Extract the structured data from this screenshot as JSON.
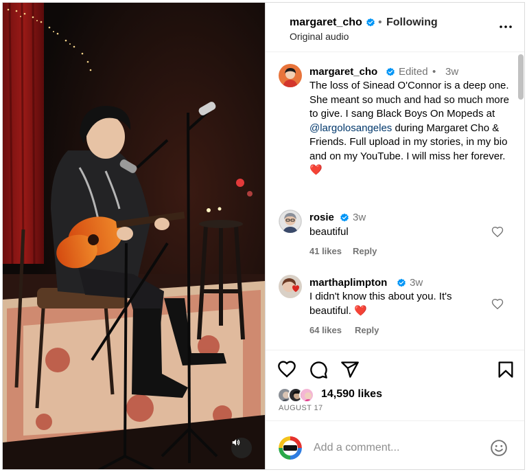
{
  "post": {
    "author": "margaret_cho",
    "follow_state": "Following",
    "separator": "•",
    "audio_label": "Original audio"
  },
  "caption": {
    "username": "margaret_cho",
    "edited": "Edited",
    "separator": "•",
    "age": "3w",
    "text_before": "The loss of Sinead O'Connor is a deep one. She meant so much and had so much more to give. I sang Black Boys On Mopeds at ",
    "mention": "@largolosangeles",
    "text_after": " during Margaret Cho & Friends. Full upload in my stories, in my bio and on my YouTube. I will miss her forever. ",
    "emoji": "❤️"
  },
  "comments": [
    {
      "username": "rosie",
      "age": "3w",
      "text": "beautiful",
      "likes": "41 likes",
      "reply": "Reply"
    },
    {
      "username": "marthaplimpton",
      "age": "3w",
      "text": "I didn't know this about you. It's beautiful. ",
      "emoji": "❤️",
      "likes": "64 likes",
      "reply": "Reply"
    }
  ],
  "engagement": {
    "likes": "14,590 likes",
    "date": "AUGUST 17"
  },
  "composer": {
    "placeholder": "Add a comment..."
  },
  "icons": {
    "verified": "verified-badge-icon",
    "more": "more-options-icon",
    "like": "heart-icon",
    "comment": "comment-icon",
    "share": "share-icon",
    "save": "bookmark-icon",
    "emoji": "emoji-icon",
    "audio": "speaker-icon"
  },
  "colors": {
    "verified": "#0095f6",
    "mention": "#00376b",
    "heart_red": "#ed4956",
    "secondary_text": "#737373"
  }
}
